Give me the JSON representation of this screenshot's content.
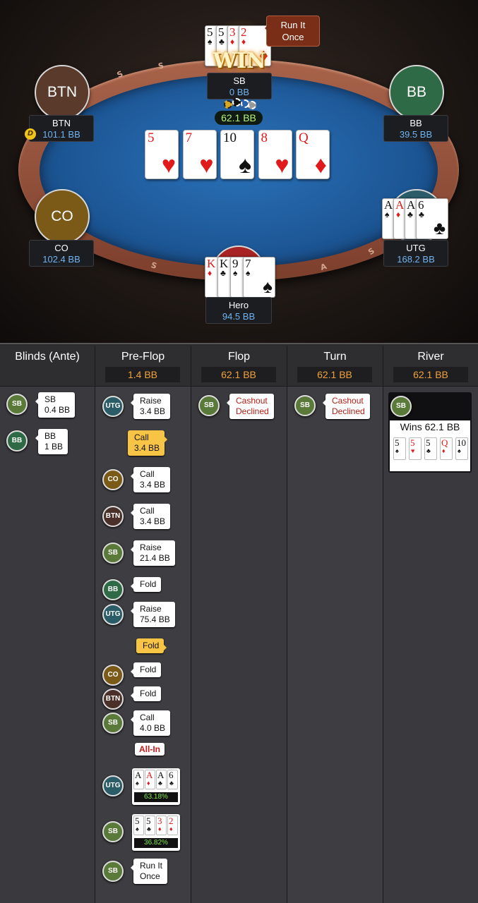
{
  "table": {
    "rail_letters": [
      "S",
      "S",
      "S",
      "S",
      "A",
      "S"
    ],
    "pot": "62.1 BB",
    "win_badge": "WIN",
    "run_it_once_tooltip": {
      "line1": "Run It",
      "line2": "Once"
    },
    "dealer_button": "D",
    "board": [
      {
        "rank": "5",
        "suit": "♥",
        "color": "red"
      },
      {
        "rank": "7",
        "suit": "♥",
        "color": "red"
      },
      {
        "rank": "10",
        "suit": "♠",
        "color": "black"
      },
      {
        "rank": "8",
        "suit": "♥",
        "color": "red"
      },
      {
        "rank": "Q",
        "suit": "♦",
        "color": "red"
      }
    ],
    "players": {
      "btn": {
        "avatar": "BTN",
        "name": "BTN",
        "stack": "101.1 BB",
        "color": "#5a3a2a"
      },
      "bb": {
        "avatar": "BB",
        "name": "BB",
        "stack": "39.5 BB",
        "color": "#2e6a45"
      },
      "co": {
        "avatar": "CO",
        "name": "CO",
        "stack": "102.4 BB",
        "color": "#7a5a16"
      },
      "utg": {
        "name": "UTG",
        "stack": "168.2 BB",
        "cards": [
          {
            "rank": "A",
            "suit": "♠",
            "color": "black"
          },
          {
            "rank": "A",
            "suit": "♦",
            "color": "red"
          },
          {
            "rank": "A",
            "suit": "♣",
            "color": "black"
          },
          {
            "rank": "6",
            "suit": "♣",
            "color": "black"
          }
        ]
      },
      "sb": {
        "name": "SB",
        "stack": "0 BB",
        "cards": [
          {
            "rank": "5",
            "suit": "♠",
            "color": "black"
          },
          {
            "rank": "5",
            "suit": "♣",
            "color": "black"
          },
          {
            "rank": "3",
            "suit": "♦",
            "color": "red"
          },
          {
            "rank": "2",
            "suit": "♦",
            "color": "red"
          }
        ]
      },
      "hero": {
        "name": "Hero",
        "stack": "94.5 BB",
        "cards": [
          {
            "rank": "K",
            "suit": "♦",
            "color": "red"
          },
          {
            "rank": "K",
            "suit": "♣",
            "color": "black"
          },
          {
            "rank": "9",
            "suit": "♠",
            "color": "black"
          },
          {
            "rank": "7",
            "suit": "♠",
            "color": "black"
          }
        ]
      }
    }
  },
  "history": {
    "columns": [
      {
        "title": "Blinds (Ante)",
        "pot": ""
      },
      {
        "title": "Pre-Flop",
        "pot": "1.4 BB"
      },
      {
        "title": "Flop",
        "pot": "62.1 BB"
      },
      {
        "title": "Turn",
        "pot": "62.1 BB"
      },
      {
        "title": "River",
        "pot": "62.1 BB"
      }
    ],
    "blinds": [
      {
        "pos": "SB",
        "line1": "SB",
        "line2": "0.4 BB"
      },
      {
        "pos": "BB",
        "line1": "BB",
        "line2": "1 BB"
      }
    ],
    "preflop": [
      {
        "pos": "UTG",
        "line1": "Raise",
        "line2": "3.4 BB"
      },
      {
        "pos": "HERO",
        "line1": "Call",
        "line2": "3.4 BB"
      },
      {
        "pos": "CO",
        "line1": "Call",
        "line2": "3.4 BB"
      },
      {
        "pos": "BTN",
        "line1": "Call",
        "line2": "3.4 BB"
      },
      {
        "pos": "SB",
        "line1": "Raise",
        "line2": "21.4 BB"
      },
      {
        "pos": "BB",
        "line1": "Fold",
        "line2": ""
      },
      {
        "pos": "UTG",
        "line1": "Raise",
        "line2": "75.4 BB"
      },
      {
        "pos": "HERO",
        "line1": "Fold",
        "line2": ""
      },
      {
        "pos": "CO",
        "line1": "Fold",
        "line2": ""
      },
      {
        "pos": "BTN",
        "line1": "Fold",
        "line2": ""
      },
      {
        "pos": "SB",
        "line1": "Call",
        "line2": "4.0 BB"
      },
      {
        "pos": "SB",
        "line1": "Run It",
        "line2": "Once"
      }
    ],
    "all_in": "All-In",
    "showdown": [
      {
        "pos": "UTG",
        "equity": "63.18%",
        "cards": [
          {
            "rank": "A",
            "suit": "♠",
            "color": "black"
          },
          {
            "rank": "A",
            "suit": "♦",
            "color": "red"
          },
          {
            "rank": "A",
            "suit": "♣",
            "color": "black"
          },
          {
            "rank": "6",
            "suit": "♣",
            "color": "black"
          }
        ]
      },
      {
        "pos": "SB",
        "equity": "36.82%",
        "cards": [
          {
            "rank": "5",
            "suit": "♠",
            "color": "black"
          },
          {
            "rank": "5",
            "suit": "♣",
            "color": "black"
          },
          {
            "rank": "3",
            "suit": "♦",
            "color": "red"
          },
          {
            "rank": "2",
            "suit": "♦",
            "color": "red"
          }
        ]
      }
    ],
    "flop": [
      {
        "pos": "SB",
        "line1": "Cashout",
        "line2": "Declined"
      }
    ],
    "turn": [
      {
        "pos": "SB",
        "line1": "Cashout",
        "line2": "Declined"
      }
    ],
    "river": {
      "pos": "SB",
      "text": "Wins 62.1 BB",
      "cards": [
        {
          "rank": "5",
          "suit": "♠",
          "color": "black"
        },
        {
          "rank": "5",
          "suit": "♥",
          "color": "red"
        },
        {
          "rank": "5",
          "suit": "♣",
          "color": "black"
        },
        {
          "rank": "Q",
          "suit": "♦",
          "color": "red"
        },
        {
          "rank": "10",
          "suit": "♠",
          "color": "black"
        }
      ]
    }
  }
}
